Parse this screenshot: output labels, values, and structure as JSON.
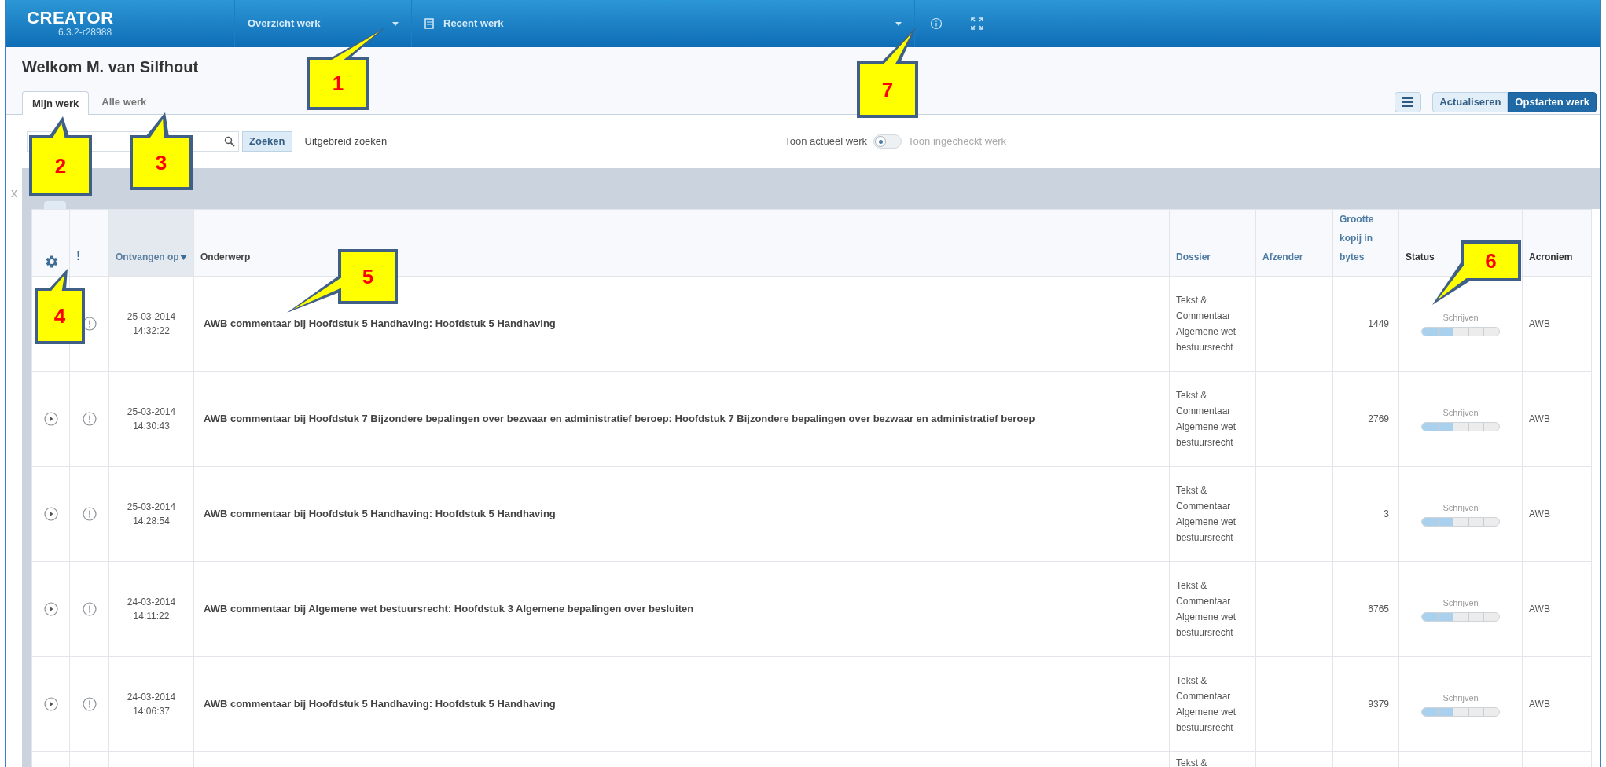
{
  "topbar": {
    "logo": "CREATOR",
    "version": "6.3.2-r28988",
    "menus": [
      {
        "label": "Overzicht werk"
      },
      {
        "label": "Recent werk"
      }
    ]
  },
  "welcome": "Welkom M. van Silfhout",
  "tabs": [
    {
      "label": "Mijn werk",
      "selected": true
    },
    {
      "label": "Alle werk",
      "selected": false
    }
  ],
  "actions": {
    "actualize": "Actualiseren",
    "start": "Opstarten werk"
  },
  "search": {
    "button": "Zoeken",
    "advanced": "Uitgebreid zoeken"
  },
  "toggle": {
    "left_label": "Toon actueel werk",
    "right_label": "Toon ingecheckt werk",
    "on": false
  },
  "band_close": "x",
  "table": {
    "columns": [
      {
        "label": "!"
      },
      {
        "label": "Ontvangen op",
        "sorted": true
      },
      {
        "label": "Onderwerp"
      },
      {
        "label": "Dossier"
      },
      {
        "label": "Afzender"
      },
      {
        "label": "Grootte kopij in bytes"
      },
      {
        "label": "Status"
      },
      {
        "label": "Acroniem"
      }
    ],
    "rows": [
      {
        "icons": [
          {
            "kind": "alert"
          }
        ],
        "date": "25-03-2014",
        "time": "14:32:22",
        "subject": "AWB commentaar bij Hoofdstuk 5 Handhaving: Hoofdstuk 5 Handhaving",
        "dossier": "Tekst & Commentaar Algemene wet bestuursrecht",
        "size": "1449",
        "status": "Schrijven",
        "level": 0.4,
        "acronym": "AWB"
      },
      {
        "icons": [
          {
            "kind": "play"
          },
          {
            "kind": "alert"
          }
        ],
        "date": "25-03-2014",
        "time": "14:30:43",
        "subject": "AWB commentaar bij Hoofdstuk 7 Bijzondere bepalingen over bezwaar en administratief beroep: Hoofdstuk 7 Bijzondere bepalingen over bezwaar en administratief beroep",
        "dossier": "Tekst & Commentaar Algemene wet bestuursrecht",
        "size": "2769",
        "status": "Schrijven",
        "level": 0.4,
        "acronym": "AWB"
      },
      {
        "icons": [
          {
            "kind": "play"
          },
          {
            "kind": "alert"
          }
        ],
        "date": "25-03-2014",
        "time": "14:28:54",
        "subject": "AWB commentaar bij Hoofdstuk 5 Handhaving: Hoofdstuk 5 Handhaving",
        "dossier": "Tekst & Commentaar Algemene wet bestuursrecht",
        "size": "3",
        "status": "Schrijven",
        "level": 0.4,
        "acronym": "AWB"
      },
      {
        "icons": [
          {
            "kind": "play"
          },
          {
            "kind": "alert"
          }
        ],
        "date": "24-03-2014",
        "time": "14:11:22",
        "subject": "AWB commentaar bij Algemene wet bestuursrecht: Hoofdstuk 3 Algemene bepalingen over besluiten",
        "dossier": "Tekst & Commentaar Algemene wet bestuursrecht",
        "size": "6765",
        "status": "Schrijven",
        "level": 0.4,
        "acronym": "AWB"
      },
      {
        "icons": [
          {
            "kind": "play"
          },
          {
            "kind": "alert"
          }
        ],
        "date": "24-03-2014",
        "time": "14:06:37",
        "subject": "AWB commentaar bij Hoofdstuk 5 Handhaving: Hoofdstuk 5 Handhaving",
        "dossier": "Tekst & Commentaar Algemene wet bestuursrecht",
        "size": "9379",
        "status": "Schrijven",
        "level": 0.4,
        "acronym": "AWB"
      },
      {
        "dossier": "Tekst &"
      }
    ]
  },
  "callouts": [
    {
      "number": "1"
    },
    {
      "number": "7"
    },
    {
      "number": "2"
    },
    {
      "number": "3"
    },
    {
      "number": "4"
    },
    {
      "number": "5"
    },
    {
      "number": "6"
    }
  ]
}
